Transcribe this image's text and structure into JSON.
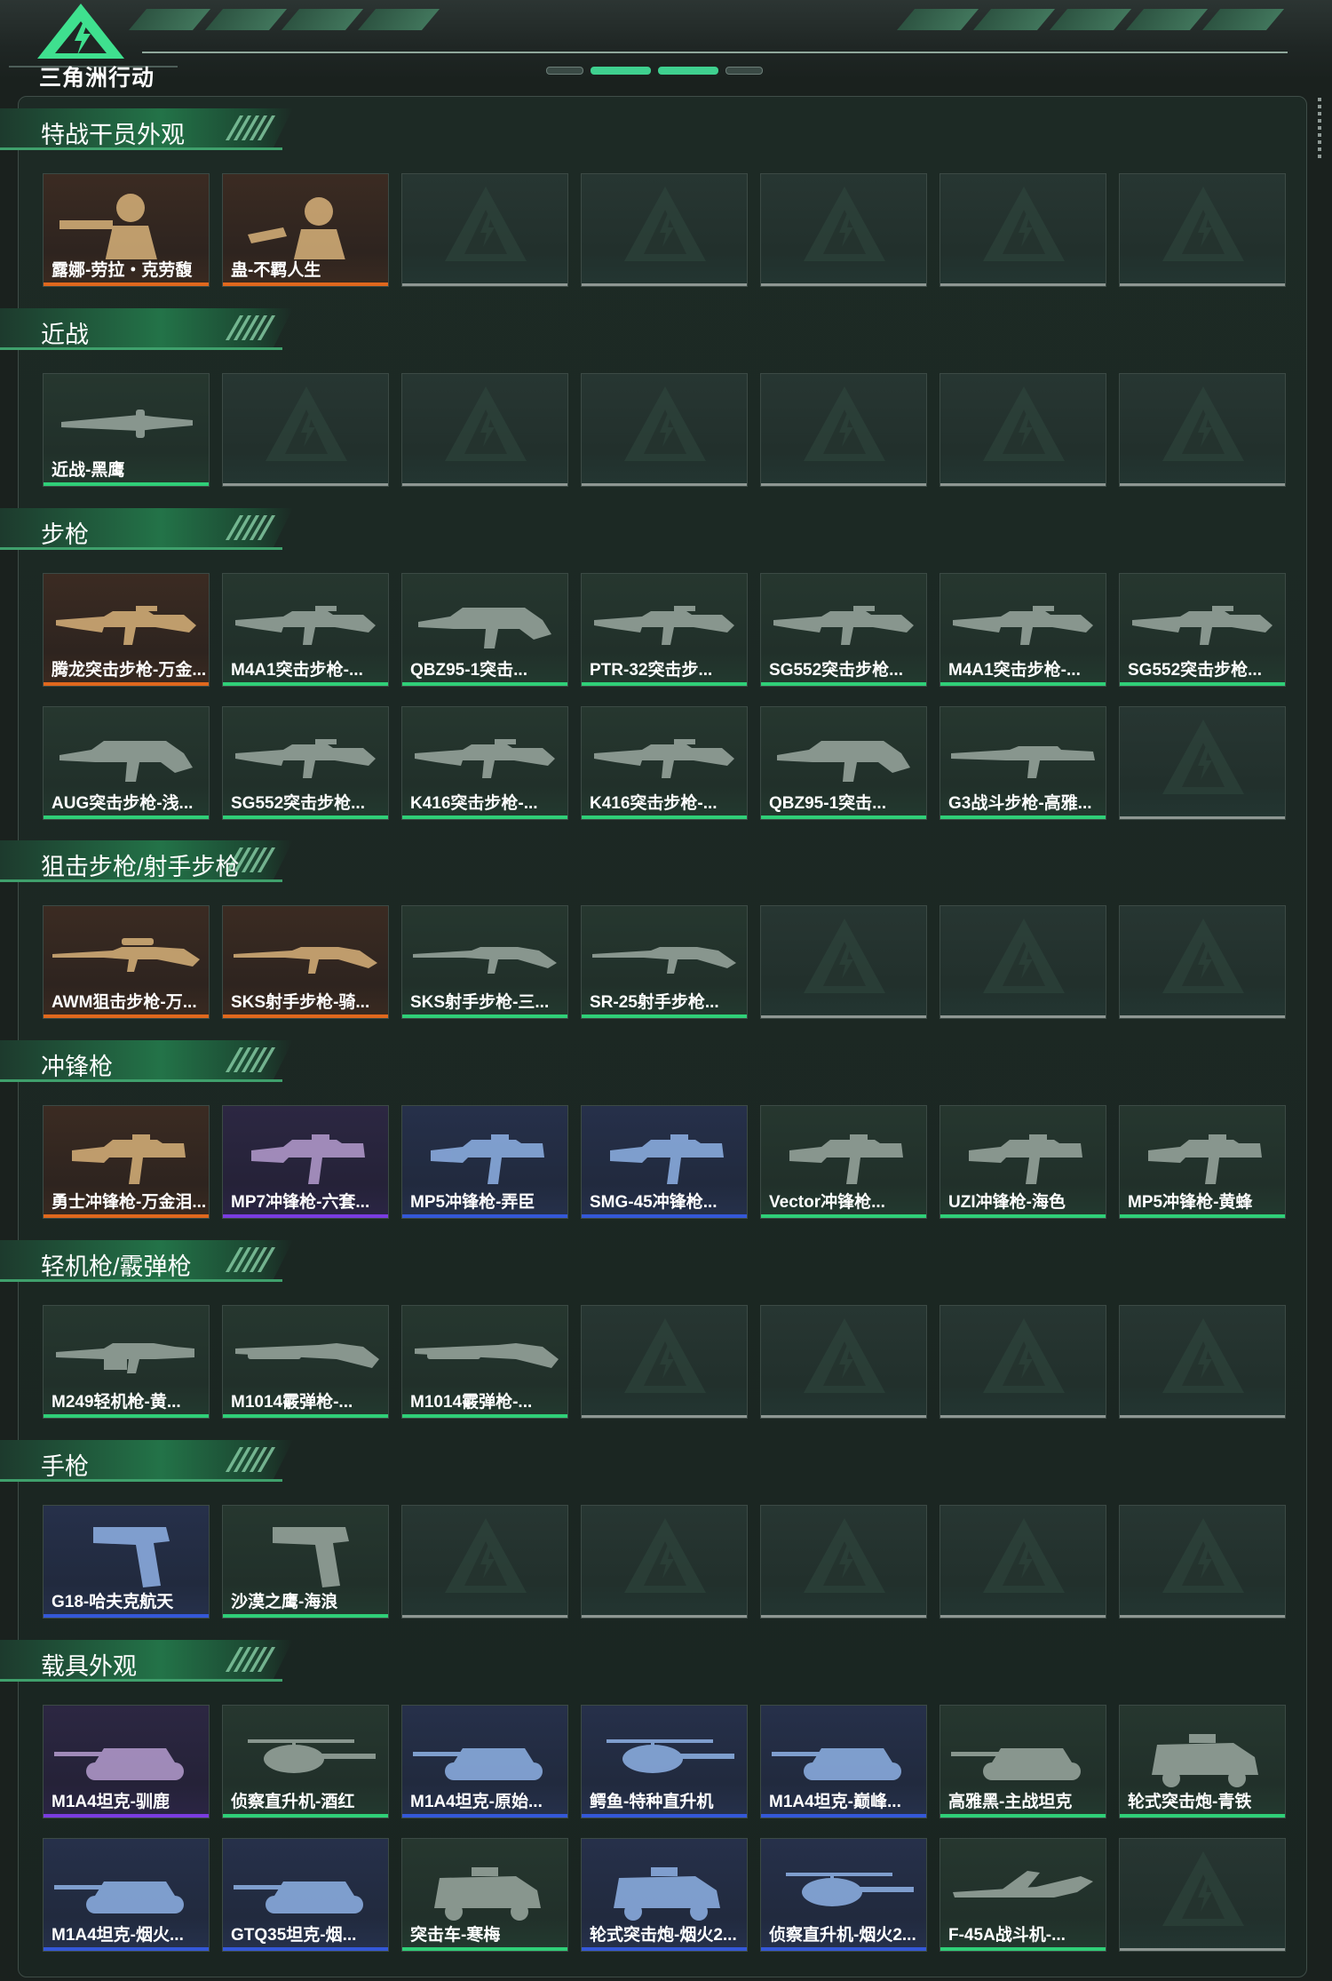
{
  "app": {
    "logo_text": "三角洲行动"
  },
  "colors": {
    "orange": "#e0681d",
    "green": "#2fcf78",
    "purple": "#7a3ce0",
    "blue": "#3458d8",
    "placeholder": "#8e9793"
  },
  "sections": [
    {
      "title": "特战干员外观",
      "rows": 1,
      "items": [
        {
          "label": "露娜-劳拉・克劳馥",
          "rarity": "orange",
          "icon": "operator-luna-skin-icon"
        },
        {
          "label": "蛊-不羁人生",
          "rarity": "orange",
          "icon": "operator-gu-skin-icon"
        }
      ]
    },
    {
      "title": "近战",
      "rows": 1,
      "items": [
        {
          "label": "近战-黑鹰",
          "rarity": "green",
          "icon": "knife-icon"
        }
      ]
    },
    {
      "title": "步枪",
      "rows": 2,
      "items": [
        {
          "label": "腾龙突击步枪-万金...",
          "rarity": "orange",
          "icon": "assault-rifle-icon"
        },
        {
          "label": "M4A1突击步枪-...",
          "rarity": "green",
          "icon": "assault-rifle-icon"
        },
        {
          "label": "QBZ95-1突击...",
          "rarity": "green",
          "icon": "bullpup-rifle-icon"
        },
        {
          "label": "PTR-32突击步...",
          "rarity": "green",
          "icon": "assault-rifle-icon"
        },
        {
          "label": "SG552突击步枪...",
          "rarity": "green",
          "icon": "assault-rifle-icon"
        },
        {
          "label": "M4A1突击步枪-...",
          "rarity": "green",
          "icon": "assault-rifle-icon"
        },
        {
          "label": "SG552突击步枪...",
          "rarity": "green",
          "icon": "assault-rifle-icon"
        },
        {
          "label": "AUG突击步枪-浅...",
          "rarity": "green",
          "icon": "bullpup-rifle-icon"
        },
        {
          "label": "SG552突击步枪...",
          "rarity": "green",
          "icon": "assault-rifle-icon"
        },
        {
          "label": "K416突击步枪-...",
          "rarity": "green",
          "icon": "assault-rifle-icon"
        },
        {
          "label": "K416突击步枪-...",
          "rarity": "green",
          "icon": "assault-rifle-icon"
        },
        {
          "label": "QBZ95-1突击...",
          "rarity": "green",
          "icon": "bullpup-rifle-icon"
        },
        {
          "label": "G3战斗步枪-高雅...",
          "rarity": "green",
          "icon": "battle-rifle-icon"
        }
      ]
    },
    {
      "title": "狙击步枪/射手步枪",
      "rows": 1,
      "items": [
        {
          "label": "AWM狙击步枪-万...",
          "rarity": "orange",
          "icon": "sniper-rifle-icon"
        },
        {
          "label": "SKS射手步枪-骑...",
          "rarity": "orange",
          "icon": "marksman-rifle-icon"
        },
        {
          "label": "SKS射手步枪-三...",
          "rarity": "green",
          "icon": "marksman-rifle-icon"
        },
        {
          "label": "SR-25射手步枪...",
          "rarity": "green",
          "icon": "marksman-rifle-icon"
        }
      ]
    },
    {
      "title": "冲锋枪",
      "rows": 1,
      "items": [
        {
          "label": "勇士冲锋枪-万金泪...",
          "rarity": "orange",
          "icon": "smg-icon"
        },
        {
          "label": "MP7冲锋枪-六套...",
          "rarity": "purple",
          "icon": "smg-icon"
        },
        {
          "label": "MP5冲锋枪-弄臣",
          "rarity": "blue",
          "icon": "smg-icon"
        },
        {
          "label": "SMG-45冲锋枪...",
          "rarity": "blue",
          "icon": "smg-icon"
        },
        {
          "label": "Vector冲锋枪...",
          "rarity": "green",
          "icon": "smg-icon"
        },
        {
          "label": "UZI冲锋枪-海色",
          "rarity": "green",
          "icon": "smg-icon"
        },
        {
          "label": "MP5冲锋枪-黄蜂",
          "rarity": "green",
          "icon": "smg-icon"
        }
      ]
    },
    {
      "title": "轻机枪/霰弹枪",
      "rows": 1,
      "items": [
        {
          "label": "M249轻机枪-黄...",
          "rarity": "green",
          "icon": "lmg-icon"
        },
        {
          "label": "M1014霰弹枪-...",
          "rarity": "green",
          "icon": "shotgun-icon"
        },
        {
          "label": "M1014霰弹枪-...",
          "rarity": "green",
          "icon": "shotgun-icon"
        }
      ]
    },
    {
      "title": "手枪",
      "rows": 1,
      "items": [
        {
          "label": "G18-哈夫克航天",
          "rarity": "blue",
          "icon": "pistol-icon"
        },
        {
          "label": "沙漠之鹰-海浪",
          "rarity": "green",
          "icon": "pistol-icon"
        }
      ]
    },
    {
      "title": "载具外观",
      "rows": 2,
      "items": [
        {
          "label": "M1A4坦克-驯鹿",
          "rarity": "purple",
          "icon": "tank-icon"
        },
        {
          "label": "侦察直升机-酒红",
          "rarity": "green",
          "icon": "helicopter-icon"
        },
        {
          "label": "M1A4坦克-原始...",
          "rarity": "blue",
          "icon": "tank-icon"
        },
        {
          "label": "鳄鱼-特种直升机",
          "rarity": "blue",
          "icon": "helicopter-icon"
        },
        {
          "label": "M1A4坦克-巅峰...",
          "rarity": "blue",
          "icon": "tank-icon"
        },
        {
          "label": "高雅黑-主战坦克",
          "rarity": "green",
          "icon": "tank-icon"
        },
        {
          "label": "轮式突击炮-青铁",
          "rarity": "green",
          "icon": "armored-car-icon"
        },
        {
          "label": "M1A4坦克-烟火...",
          "rarity": "blue",
          "icon": "tank-icon"
        },
        {
          "label": "GTQ35坦克-烟...",
          "rarity": "blue",
          "icon": "tank-icon"
        },
        {
          "label": "突击车-寒梅",
          "rarity": "green",
          "icon": "armored-car-icon"
        },
        {
          "label": "轮式突击炮-烟火2...",
          "rarity": "blue",
          "icon": "armored-car-icon"
        },
        {
          "label": "侦察直升机-烟火2...",
          "rarity": "blue",
          "icon": "helicopter-icon"
        },
        {
          "label": "F-45A战斗机-...",
          "rarity": "green",
          "icon": "jet-icon"
        }
      ]
    }
  ]
}
